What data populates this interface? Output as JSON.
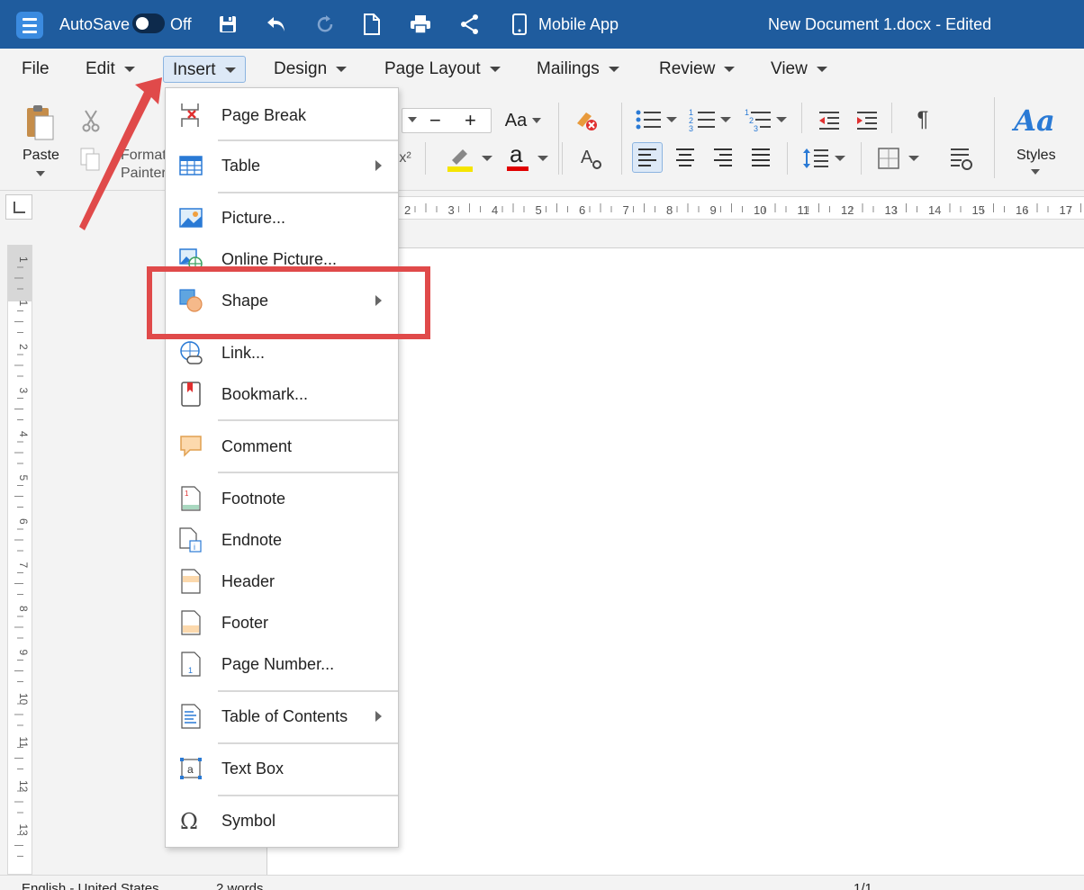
{
  "titlebar": {
    "autosave_label": "AutoSave",
    "autosave_state": "Off",
    "mobile_app_label": "Mobile App",
    "document_title": "New Document 1.docx - Edited"
  },
  "menubar": {
    "items": [
      {
        "label": "File"
      },
      {
        "label": "Edit"
      },
      {
        "label": "Insert",
        "active": true
      },
      {
        "label": "Design"
      },
      {
        "label": "Page Layout"
      },
      {
        "label": "Mailings"
      },
      {
        "label": "Review"
      },
      {
        "label": "View"
      }
    ]
  },
  "ribbon": {
    "paste_label": "Paste",
    "format_painter_line1": "Format",
    "format_painter_line2": "Painter",
    "styles_label": "Styles",
    "font_size_minus": "−",
    "font_size_plus": "+",
    "change_case": "Aa",
    "superscript": "x²",
    "font_color_letter": "a",
    "styles_glyph": "Aa",
    "paragraph_mark": "¶",
    "highlight_color": "#f5e500",
    "font_color": "#e00000"
  },
  "ruler": {
    "h_ticks": [
      "2",
      "3",
      "4",
      "5",
      "6",
      "7",
      "8",
      "9",
      "10",
      "11",
      "12",
      "13",
      "14",
      "15",
      "16",
      "17"
    ],
    "v_ticks": [
      "1",
      "1",
      "2",
      "3",
      "4",
      "5",
      "6",
      "7",
      "8",
      "9",
      "10",
      "11",
      "12",
      "13"
    ]
  },
  "insert_menu": {
    "items": [
      {
        "label": "Page Break",
        "icon": "page-break-icon"
      },
      {
        "label": "Table",
        "icon": "table-icon",
        "submenu": true
      },
      {
        "label": "Picture...",
        "icon": "picture-icon"
      },
      {
        "label": "Online Picture...",
        "icon": "online-picture-icon"
      },
      {
        "label": "Shape",
        "icon": "shape-icon",
        "submenu": true
      },
      {
        "label": "Link...",
        "icon": "link-icon"
      },
      {
        "label": "Bookmark...",
        "icon": "bookmark-icon"
      },
      {
        "label": "Comment",
        "icon": "comment-icon"
      },
      {
        "label": "Footnote",
        "icon": "footnote-icon"
      },
      {
        "label": "Endnote",
        "icon": "endnote-icon"
      },
      {
        "label": "Header",
        "icon": "header-icon"
      },
      {
        "label": "Footer",
        "icon": "footer-icon"
      },
      {
        "label": "Page Number...",
        "icon": "page-number-icon"
      },
      {
        "label": "Table of Contents",
        "icon": "toc-icon",
        "submenu": true
      },
      {
        "label": "Text Box",
        "icon": "text-box-icon"
      },
      {
        "label": "Symbol",
        "icon": "symbol-icon"
      }
    ]
  },
  "statusbar": {
    "language": "English - United States",
    "word_count": "2 words",
    "page_indicator": "1/1"
  },
  "colors": {
    "titlebar": "#1f5c9e",
    "annotation_red": "#e04a4a",
    "accent_blue": "#2a7ad5"
  }
}
